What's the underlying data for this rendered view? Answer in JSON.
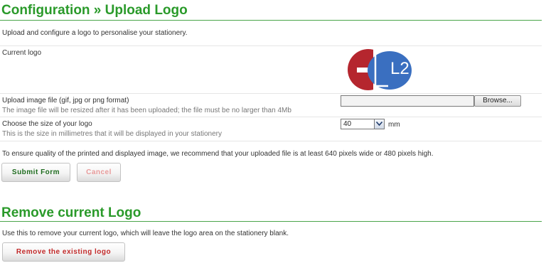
{
  "upload_section": {
    "title": "Configuration » Upload Logo",
    "intro": "Upload and configure a logo to personalise your stationery.",
    "current_logo_label": "Current logo",
    "logo": {
      "text": "L2",
      "colors": {
        "red": "#b5262e",
        "blue": "#3a6fc0"
      }
    },
    "upload_field": {
      "label": "Upload image file (gif, jpg or png format)",
      "hint": "The image file will be resized after it has been uploaded; the file must be no larger than 4Mb",
      "value": "",
      "browse_label": "Browse..."
    },
    "size_field": {
      "label": "Choose the size of your logo",
      "hint": "This is the size in millimetres that it will be displayed in your stationery",
      "selected": "40",
      "unit": "mm"
    },
    "quality_note": "To ensure quality of the printed and displayed image, we recommend that your uploaded file is at least 640 pixels wide or 480 pixels high.",
    "submit_label": "Submit Form",
    "cancel_label": "Cancel"
  },
  "remove_section": {
    "title": "Remove current Logo",
    "description": "Use this to remove your current logo, which will leave the logo area on the stationery blank.",
    "remove_label": "Remove the existing logo"
  },
  "colors": {
    "heading_green": "#2a9a2a",
    "submit_text": "#1d6a1d",
    "cancel_text": "#e89a9a",
    "remove_text": "#c22a2a"
  }
}
